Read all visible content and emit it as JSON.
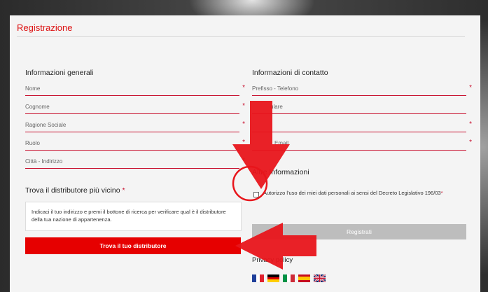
{
  "form": {
    "title": "Registrazione",
    "general": {
      "heading": "Informazioni generali",
      "fields": [
        "Nome",
        "Cognome",
        "Ragione Sociale",
        "Ruolo",
        "Città - Indirizzo"
      ],
      "required_mark": "*"
    },
    "contact": {
      "heading": "Informazioni di contatto",
      "fields": [
        "Prefisso - Telefono",
        "ulare",
        "",
        "Email"
      ],
      "required_mark": "*"
    },
    "distributor": {
      "heading": "Trova il distributore più vicino",
      "required_mark": "*",
      "info": "Indicaci il tuo indirizzo e premi il bottone di ricerca per verificare qual è il distributore della tua nazione di appartenenza.",
      "button": "Trova il tuo distributore"
    },
    "other": {
      "heading": "Altre Informazioni",
      "consent_text": "Autorizzo l'uso dei miei dati personali ai sensi del Decreto Legislativo 196/03",
      "required_mark": "*",
      "consent_checked": false,
      "submit": "Registrati"
    },
    "privacy": "Privacy policy",
    "languages": [
      "french-flag",
      "german-flag",
      "italian-flag",
      "spanish-flag",
      "uk-flag"
    ]
  },
  "colors": {
    "accent": "#e60000",
    "annotation": "#e8151b",
    "disabled_button": "#bdbdbd"
  }
}
